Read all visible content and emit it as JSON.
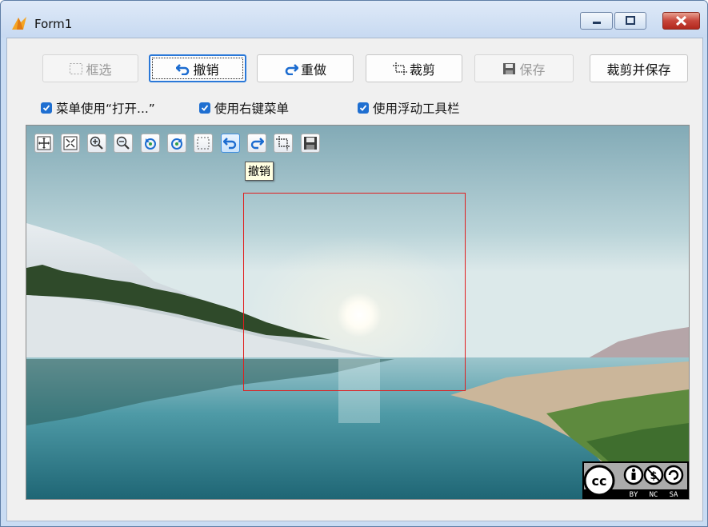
{
  "window": {
    "title": "Form1"
  },
  "toolbar": {
    "select_label": "框选",
    "undo_label": "撤销",
    "redo_label": "重做",
    "crop_label": "裁剪",
    "save_label": "保存",
    "crop_save_label": "裁剪并保存"
  },
  "options": {
    "menu_open_label": "菜单使用“打开...”",
    "context_menu_label": "使用右键菜单",
    "float_toolbar_label": "使用浮动工具栏"
  },
  "viewer": {
    "tooltip": "撤销",
    "license": {
      "by": "BY",
      "nc": "NC",
      "sa": "SA"
    }
  },
  "colors": {
    "accent": "#1f6fd1",
    "selection": "#e01e1e",
    "tooltip_bg": "#ffffe1"
  }
}
